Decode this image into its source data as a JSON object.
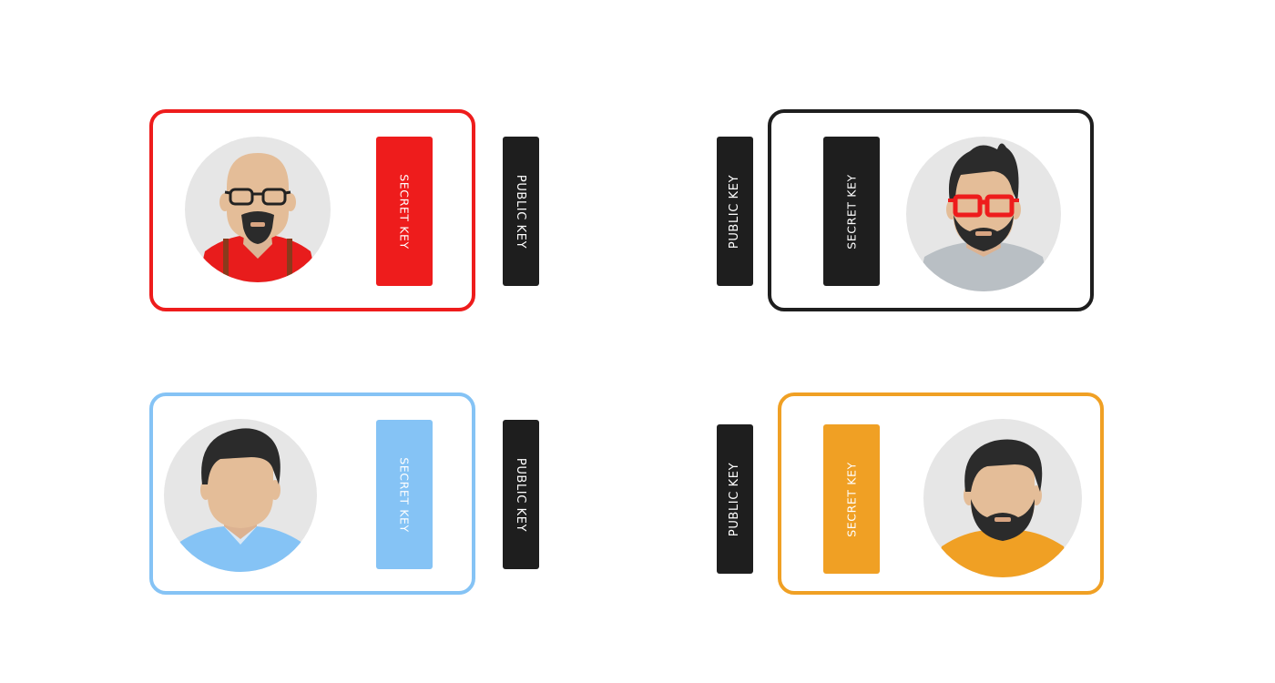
{
  "users": [
    {
      "id": "red",
      "color": "#ee1c1c",
      "avatar": "bald-man-with-glasses-icon",
      "secret_key": "SECRET KEY",
      "public_key": "PUBLIC KEY"
    },
    {
      "id": "black",
      "color": "#1e1e1e",
      "avatar": "man-with-red-glasses-icon",
      "secret_key": "SECRET KEY",
      "public_key": "PUBLIC KEY"
    },
    {
      "id": "blue",
      "color": "#85c3f5",
      "avatar": "man-with-dark-hair-icon",
      "secret_key": "SECRET KEY",
      "public_key": "PUBLIC KEY"
    },
    {
      "id": "orange",
      "color": "#f0a024",
      "avatar": "bearded-man-icon",
      "secret_key": "SECRET KEY",
      "public_key": "PUBLIC KEY"
    }
  ],
  "public_key_color": "#1e1e1e"
}
